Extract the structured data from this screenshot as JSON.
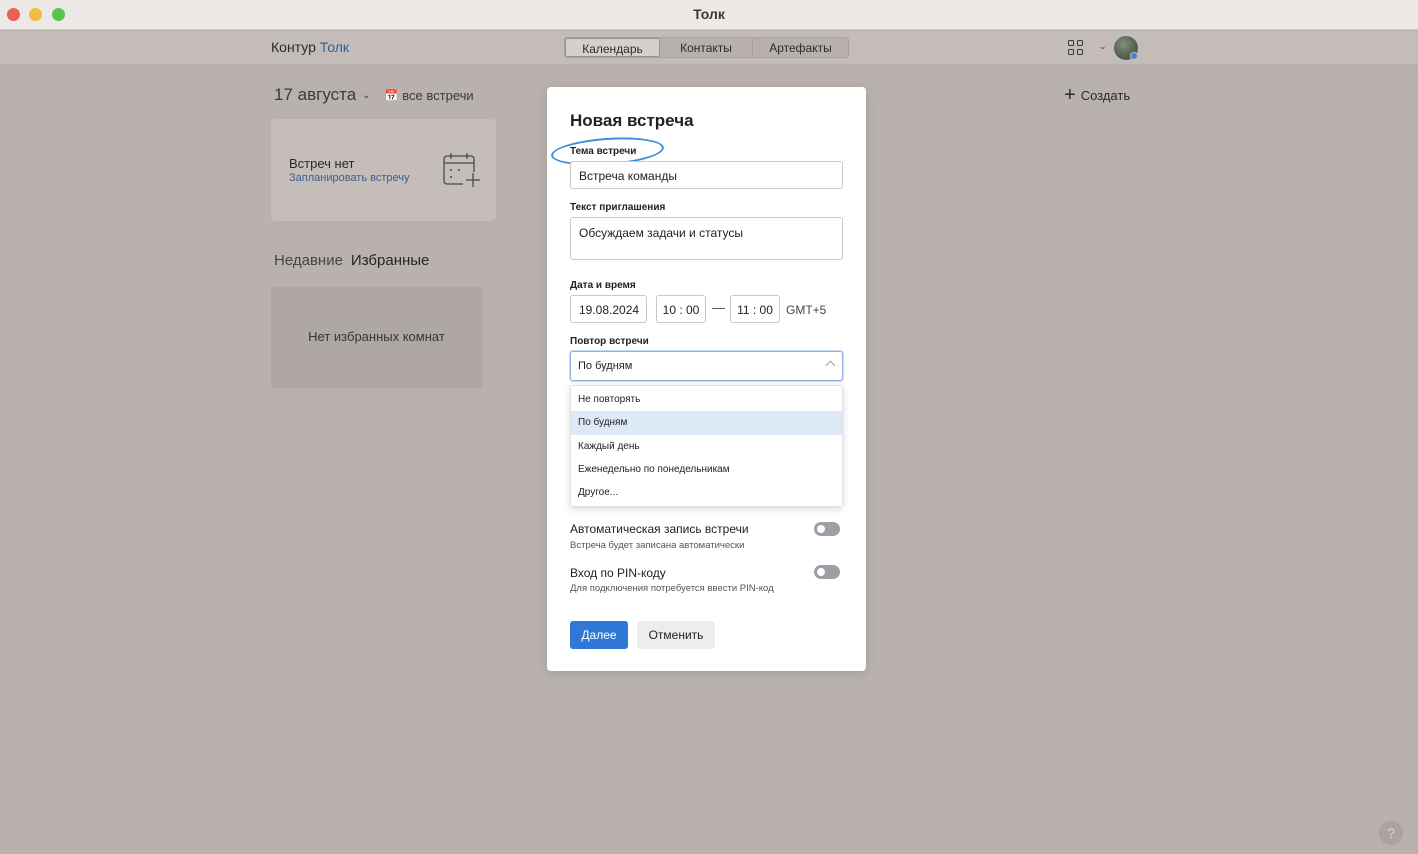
{
  "window": {
    "title": "Толк"
  },
  "header": {
    "logo_part1": "Контур",
    "logo_part2": "Толк",
    "tabs": [
      {
        "label": "Календарь",
        "active": true
      },
      {
        "label": "Контакты",
        "active": false
      },
      {
        "label": "Артефакты",
        "active": false
      }
    ],
    "apps_icon": "grid-icon",
    "accent_color": "#30619e"
  },
  "page": {
    "date": "17 августа",
    "all_meetings": "все встречи",
    "create_label": "Создать",
    "no_meetings_title": "Встреч нет",
    "schedule_link": "Запланировать встречу",
    "tab_recent": "Недавние",
    "tab_favorites": "Избранные",
    "favorites_empty": "Нет избранных комнат",
    "help": "?"
  },
  "modal": {
    "title": "Новая встреча",
    "topic_label": "Тема встречи",
    "topic_value": "Встреча команды",
    "invite_label": "Текст приглашения",
    "invite_value": "Обсуждаем задачи и статусы",
    "datetime_label": "Дата и время",
    "date_value": "19.08.2024",
    "time_start": "10 : 00",
    "time_separator": "—",
    "time_end": "11 : 00",
    "timezone": "GMT+5",
    "repeat_label": "Повтор встречи",
    "repeat_value": "По будням",
    "repeat_options": [
      {
        "label": "Не повторять",
        "selected": false
      },
      {
        "label": "По будням",
        "selected": true
      },
      {
        "label": "Каждый день",
        "selected": false
      },
      {
        "label": "Еженедельно по понедельникам",
        "selected": false
      },
      {
        "label": "Другое...",
        "selected": false
      }
    ],
    "auto_record_title": "Автоматическая запись встречи",
    "auto_record_sub": "Встреча будет записана автоматически",
    "auto_record_on": false,
    "pin_title": "Вход по PIN-коду",
    "pin_sub": "Для подключения потребуется ввести PIN-код",
    "pin_on": false,
    "next_button": "Далее",
    "cancel_button": "Отменить",
    "primary_color": "#2f78d5",
    "highlight_color": "#3e8ee0"
  }
}
